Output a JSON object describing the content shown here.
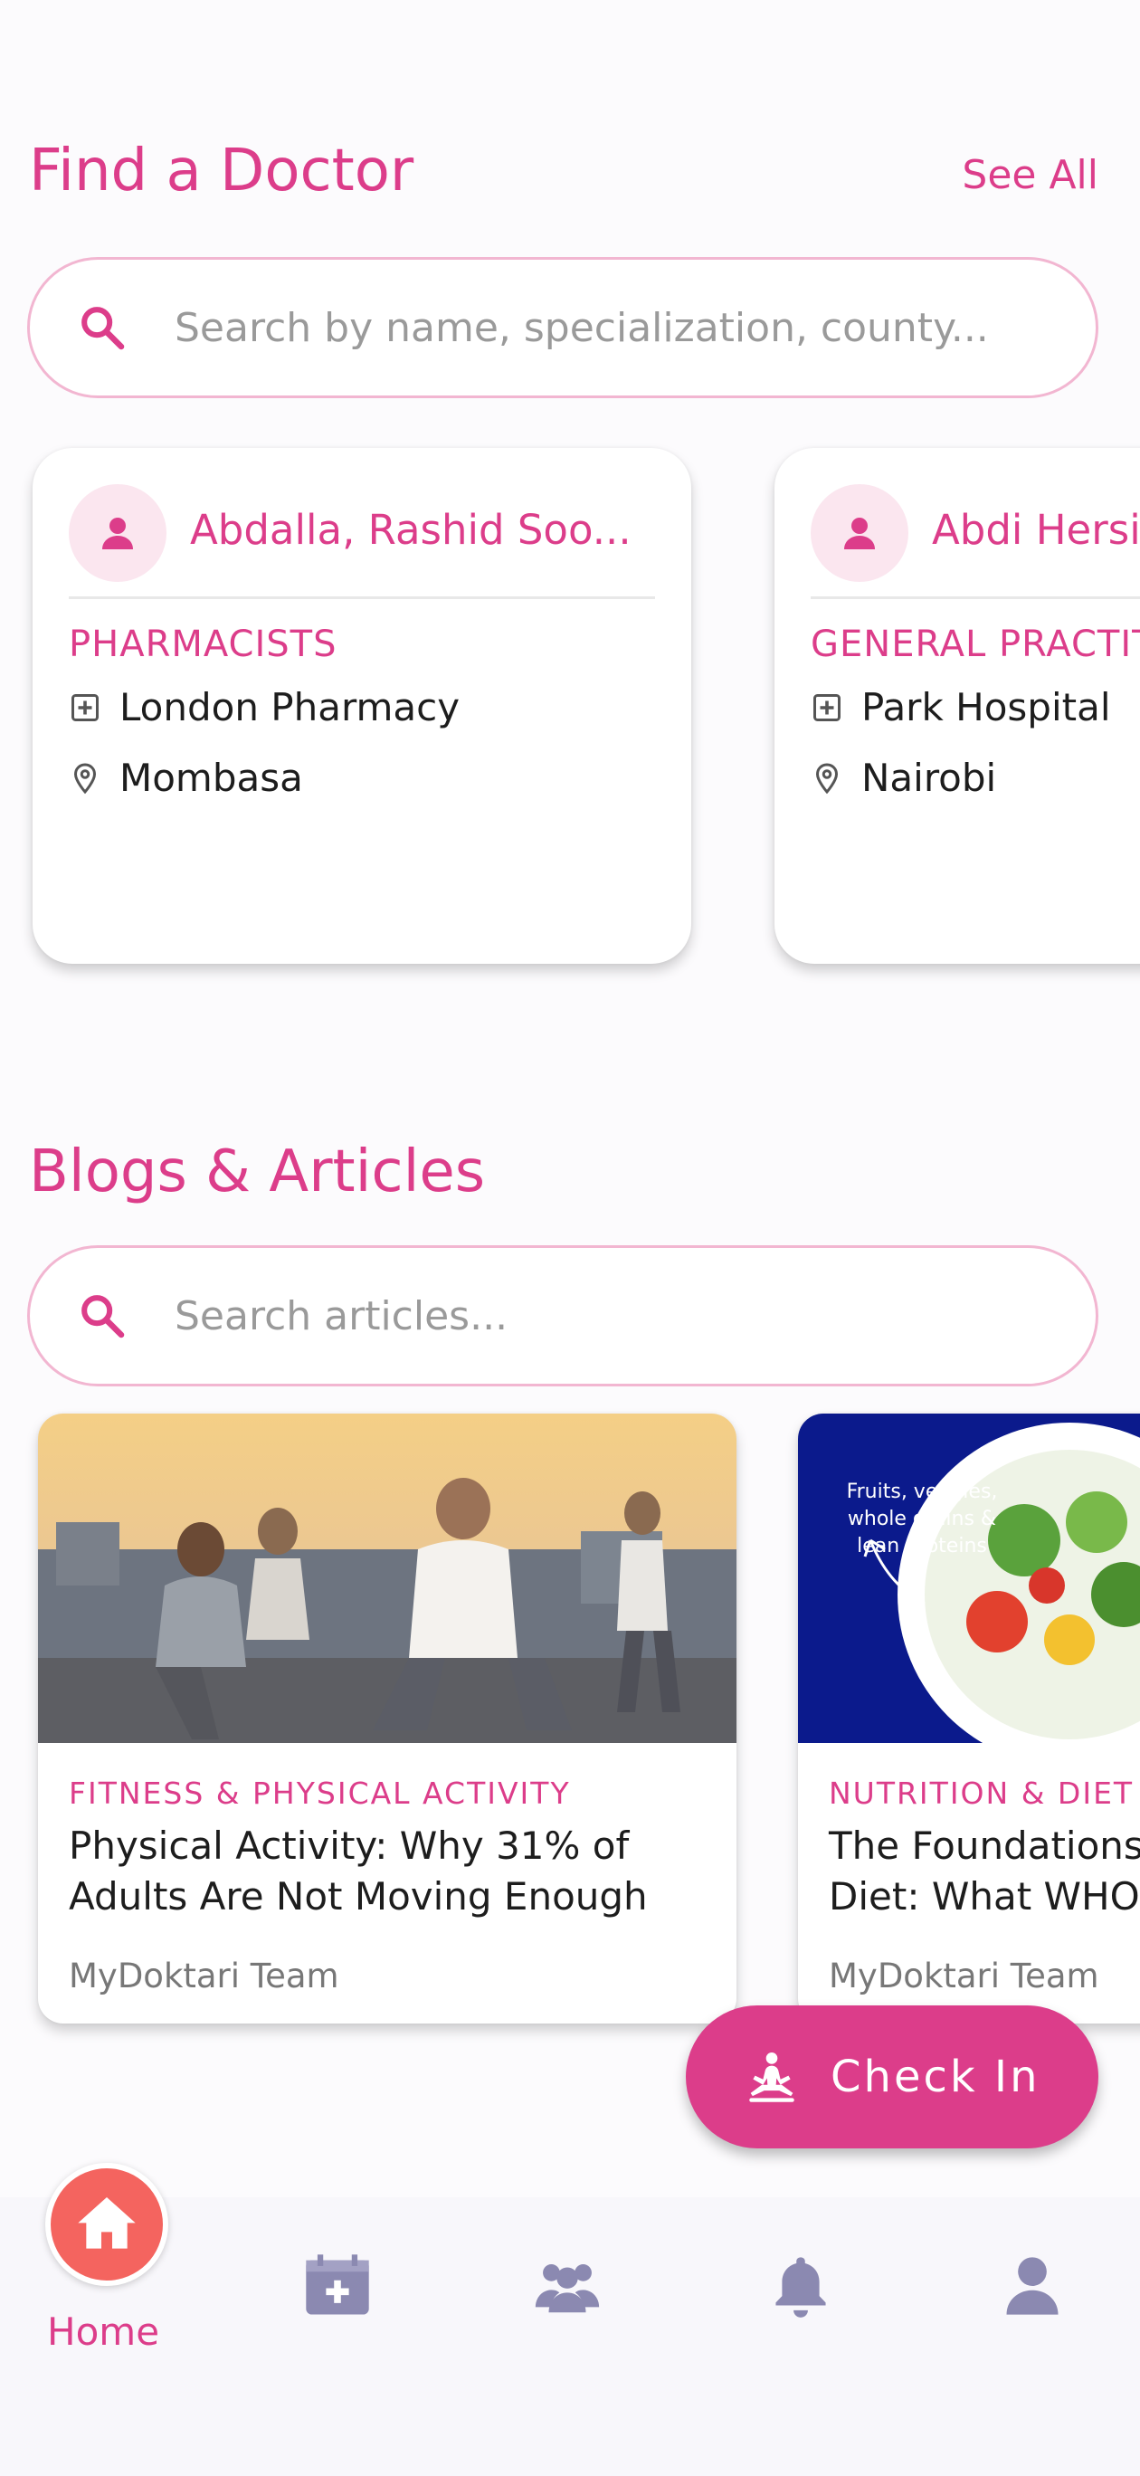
{
  "colors": {
    "accent": "#dc3d8a",
    "nav_icon": "#8b89b1",
    "home_active": "#f4645f"
  },
  "find_doctor": {
    "title": "Find a Doctor",
    "see_all": "See All",
    "search_placeholder": "Search by name, specialization, county..."
  },
  "doctors": [
    {
      "name": "Abdalla, Rashid Soo...",
      "specialty": "PHARMACISTS",
      "facility": "London Pharmacy",
      "location": "Mombasa",
      "icon": "person-icon"
    },
    {
      "name": "Abdi Hersi",
      "specialty": "GENERAL PRACTITIO",
      "facility": "Park Hospital",
      "location": "Nairobi",
      "icon": "person-icon"
    }
  ],
  "blogs_section": {
    "title": "Blogs & Articles",
    "search_placeholder": "Search articles..."
  },
  "blogs": [
    {
      "category": "FITNESS & PHYSICAL ACTIVITY",
      "title_line1": "Physical Activity: Why 31% of",
      "title_line2": "Adults Are Not Moving Enough",
      "author": "MyDoktari Team"
    },
    {
      "category": "NUTRITION & DIET",
      "title_line1": "The Foundations",
      "title_line2": "Diet: What WHO",
      "author": "MyDoktari Team",
      "image_text_line1": "Fruits, veggies,",
      "image_text_line2": "whole grains &",
      "image_text_line3": "lean proteins"
    }
  ],
  "fab": {
    "label": "Check In",
    "icon": "meditation-icon"
  },
  "bottom_nav": {
    "home_label": "Home",
    "items": [
      "home-icon",
      "medical-calendar-icon",
      "community-icon",
      "bell-icon",
      "profile-icon"
    ]
  }
}
